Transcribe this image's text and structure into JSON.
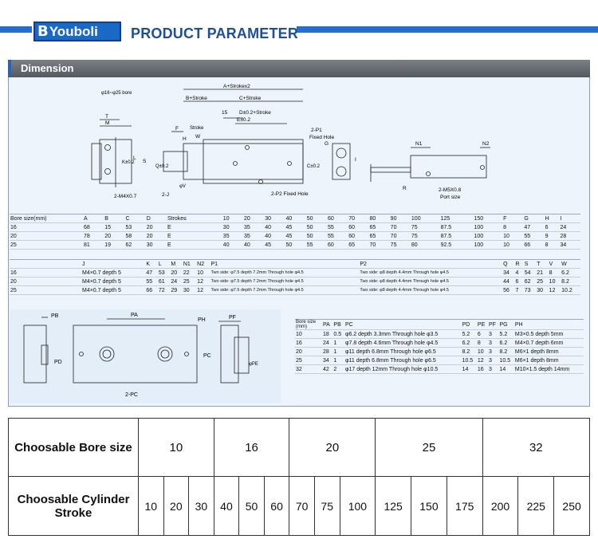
{
  "header": {
    "brand": "Youboli",
    "title": "PRODUCT PARAMETER"
  },
  "dimension": {
    "title": "Dimension",
    "bore_note": "φ16~φ25 bore",
    "labels": {
      "a_stroke": "A+Strokex2",
      "b_stroke": "B+Stroke",
      "c_stroke": "C+Stroke",
      "d": "D±0.2+Stroke",
      "e": "E±0.2",
      "fifteen": "15",
      "p1": "2-P1",
      "fixed_hole": "Fixed Hole",
      "p2": "2-P2 Fixed Hole",
      "m4": "2-M4X0.7",
      "j": "2-J",
      "t": "T",
      "m": "M",
      "k": "K±0.2",
      "l": "L",
      "s": "S",
      "q": "Q±0.2",
      "f": "F",
      "stroke": "Stroke",
      "w": "W",
      "h": "H",
      "v": "φV",
      "g": "G",
      "c02": "C±0.2",
      "i": "I",
      "r": "R",
      "n1": "N1",
      "n2": "N2",
      "m5": "2-M5X0.8",
      "port": "Port size"
    },
    "table1": {
      "headers": [
        "Bore size(mm)",
        "A",
        "B",
        "C",
        "D",
        "Stroke≤",
        "10",
        "20",
        "30",
        "40",
        "50",
        "60",
        "70",
        "80",
        "90",
        "100",
        "125",
        "150",
        "F",
        "G",
        "H",
        "I"
      ],
      "rows": [
        [
          "16",
          "68",
          "15",
          "53",
          "20",
          "E",
          "30",
          "35",
          "40",
          "45",
          "50",
          "55",
          "60",
          "65",
          "70",
          "75",
          "87.5",
          "100",
          "8",
          "47",
          "6",
          "24"
        ],
        [
          "20",
          "78",
          "20",
          "58",
          "20",
          "E",
          "35",
          "35",
          "40",
          "45",
          "50",
          "55",
          "60",
          "65",
          "70",
          "75",
          "87.5",
          "100",
          "10",
          "55",
          "9",
          "28"
        ],
        [
          "25",
          "81",
          "19",
          "62",
          "30",
          "E",
          "40",
          "40",
          "45",
          "50",
          "55",
          "60",
          "65",
          "70",
          "75",
          "80",
          "92.5",
          "100",
          "10",
          "66",
          "8",
          "34"
        ]
      ]
    },
    "table2": {
      "headers": [
        "J",
        "K",
        "L",
        "M",
        "N1",
        "N2",
        "P1",
        "P2",
        "Q",
        "R",
        "S",
        "T",
        "V",
        "W"
      ],
      "rows": [
        [
          "M4×0.7 depth 5",
          "47",
          "53",
          "20",
          "22",
          "10",
          "Two side: φ7.5 depth 7.2mm Through hole φ4.5",
          "Two side: φ8 depth 4.4mm Through hole φ4.5",
          "34",
          "4",
          "54",
          "21",
          "8",
          "6.2"
        ],
        [
          "M4×0.7 depth 5",
          "55",
          "61",
          "24",
          "25",
          "12",
          "Two side: φ7.5 depth 7.2mm Through hole φ4.5",
          "Two side: φ8 depth 4.4mm Through hole φ4.5",
          "44",
          "6",
          "62",
          "25",
          "10",
          "8.2"
        ],
        [
          "M4×0.7 depth 5",
          "66",
          "72",
          "29",
          "30",
          "12",
          "Two side: φ7.5 depth 7.2mm Through hole φ4.5",
          "Two side: φ8 depth 4.4mm Through hole φ4.5",
          "56",
          "7",
          "73",
          "30",
          "12",
          "10.2"
        ]
      ],
      "bore_col": [
        "16",
        "20",
        "25"
      ]
    },
    "drawing2": {
      "pb": "PB",
      "pa": "PA",
      "pd": "PD",
      "pc": "2-PC",
      "ph": "PH",
      "pf": "PF",
      "pc_side": "PC",
      "pe": "φPE"
    },
    "table3": {
      "headers": [
        "Bore size (mm)",
        "PA",
        "PB",
        "PC",
        "PD",
        "PE",
        "PF",
        "PG",
        "PH"
      ],
      "rows": [
        [
          "10",
          "18",
          "0.5",
          "φ6.2 depth 3.3mm Through hole φ3.5",
          "5.2",
          "6",
          "3",
          "5.2",
          "M3×0.5 depth 5mm"
        ],
        [
          "16",
          "24",
          "1",
          "φ7.8 depth 4.6mm Through hole φ4.5",
          "6.2",
          "8",
          "3",
          "6.2",
          "M4×0.7 depth 6mm"
        ],
        [
          "20",
          "28",
          "1",
          "φ11 depth 6.8mm Through hole φ6.5",
          "8.2",
          "10",
          "3",
          "8.2",
          "M6×1 depth 8mm"
        ],
        [
          "25",
          "34",
          "1",
          "φ11 depth 6.8mm Through hole φ6.5",
          "10.5",
          "12",
          "3",
          "10.5",
          "M6×1 depth 8mm"
        ],
        [
          "32",
          "42",
          "2",
          "φ17 depth 12mm Through hole φ10.5",
          "14",
          "16",
          "3",
          "14",
          "M10×1.5 depth 14mm"
        ]
      ]
    }
  },
  "choosable": {
    "bore_label": "Choosable Bore size",
    "stroke_label": "Choosable Cylinder Stroke",
    "bores": [
      "10",
      "16",
      "20",
      "25",
      "32"
    ],
    "strokes": [
      "10",
      "20",
      "30",
      "40",
      "50",
      "60",
      "70",
      "75",
      "100",
      "125",
      "150",
      "175",
      "200",
      "225",
      "250"
    ]
  },
  "colors": {
    "brand_blue": "#1b69c6",
    "title_blue": "#1d4f9c",
    "panel_bg": "#eef4fb",
    "panel_head": "#666a70"
  }
}
